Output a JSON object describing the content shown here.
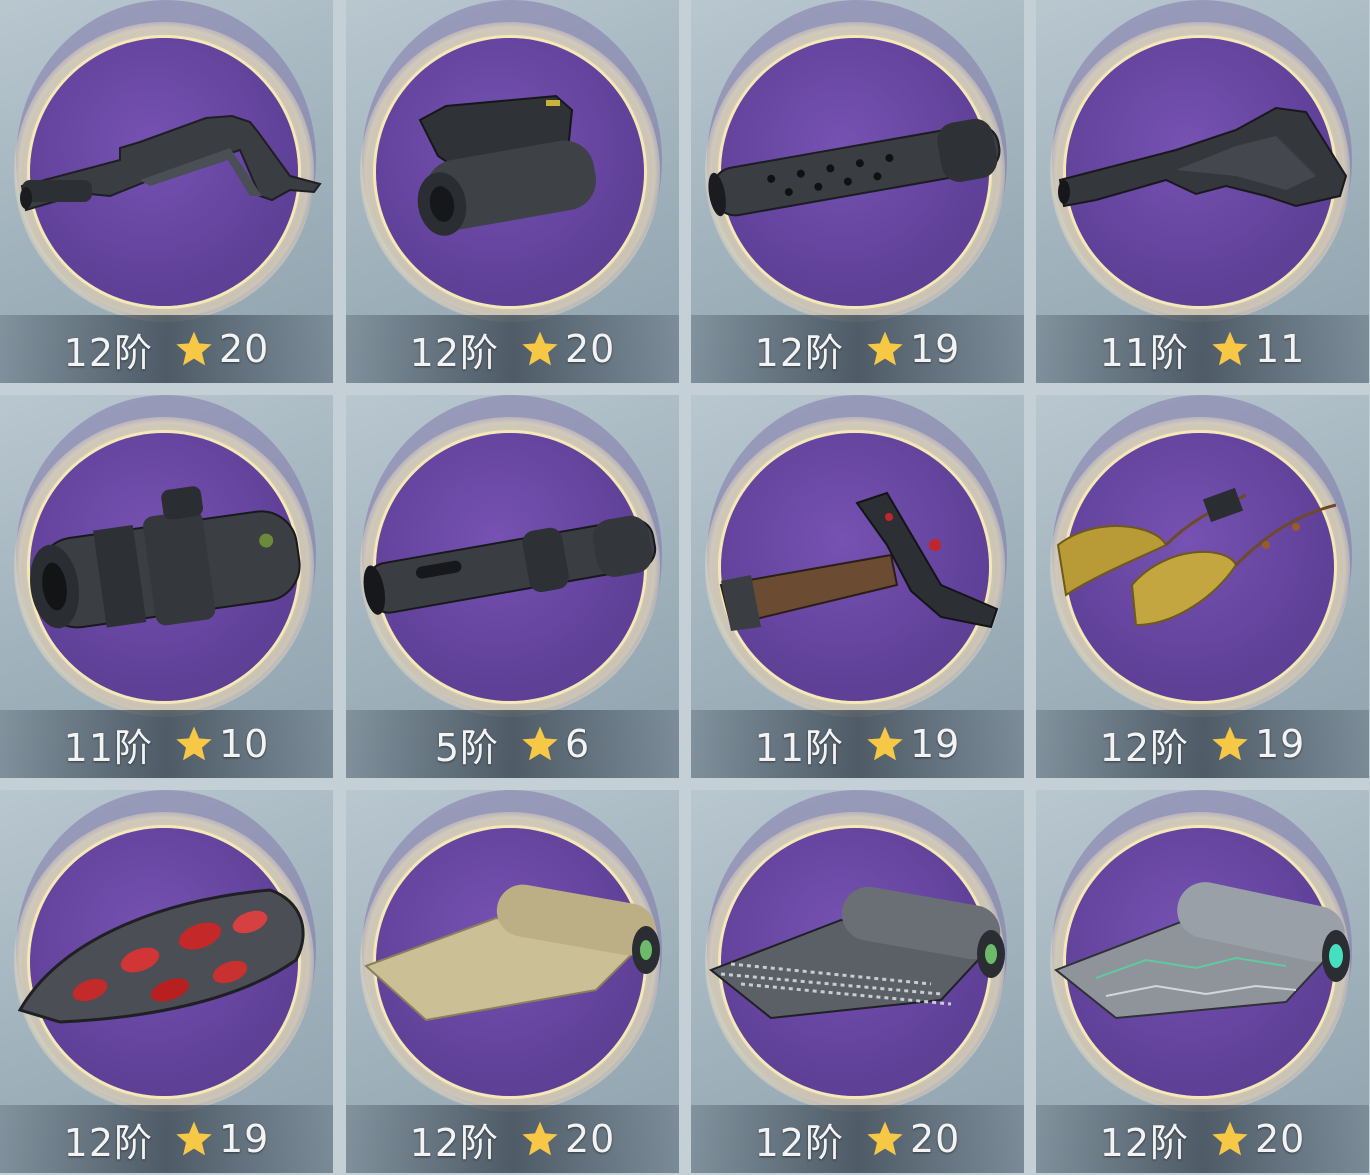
{
  "colors": {
    "disc": "#6a4aa6",
    "ring": "#f4e7b8",
    "star": "#f6c846",
    "text": "#f3f3f3"
  },
  "items": [
    {
      "tier": "12阶",
      "stars": "20",
      "icon": "rifle-stock-icon"
    },
    {
      "tier": "12阶",
      "stars": "20",
      "icon": "laser-sight-icon"
    },
    {
      "tier": "12阶",
      "stars": "19",
      "icon": "suppressor-icon"
    },
    {
      "tier": "11阶",
      "stars": "11",
      "icon": "tactical-stock-icon"
    },
    {
      "tier": "11阶",
      "stars": "10",
      "icon": "scope-icon"
    },
    {
      "tier": "5阶",
      "stars": "6",
      "icon": "muzzle-brake-icon"
    },
    {
      "tier": "11阶",
      "stars": "19",
      "icon": "ornate-grip-icon"
    },
    {
      "tier": "12阶",
      "stars": "19",
      "icon": "golden-tassel-icon"
    },
    {
      "tier": "12阶",
      "stars": "19",
      "icon": "crimson-armor-plate-icon"
    },
    {
      "tier": "12阶",
      "stars": "20",
      "icon": "cloth-roll-icon"
    },
    {
      "tier": "12阶",
      "stars": "20",
      "icon": "chainmail-roll-icon"
    },
    {
      "tier": "12阶",
      "stars": "20",
      "icon": "hex-fabric-roll-icon"
    }
  ]
}
